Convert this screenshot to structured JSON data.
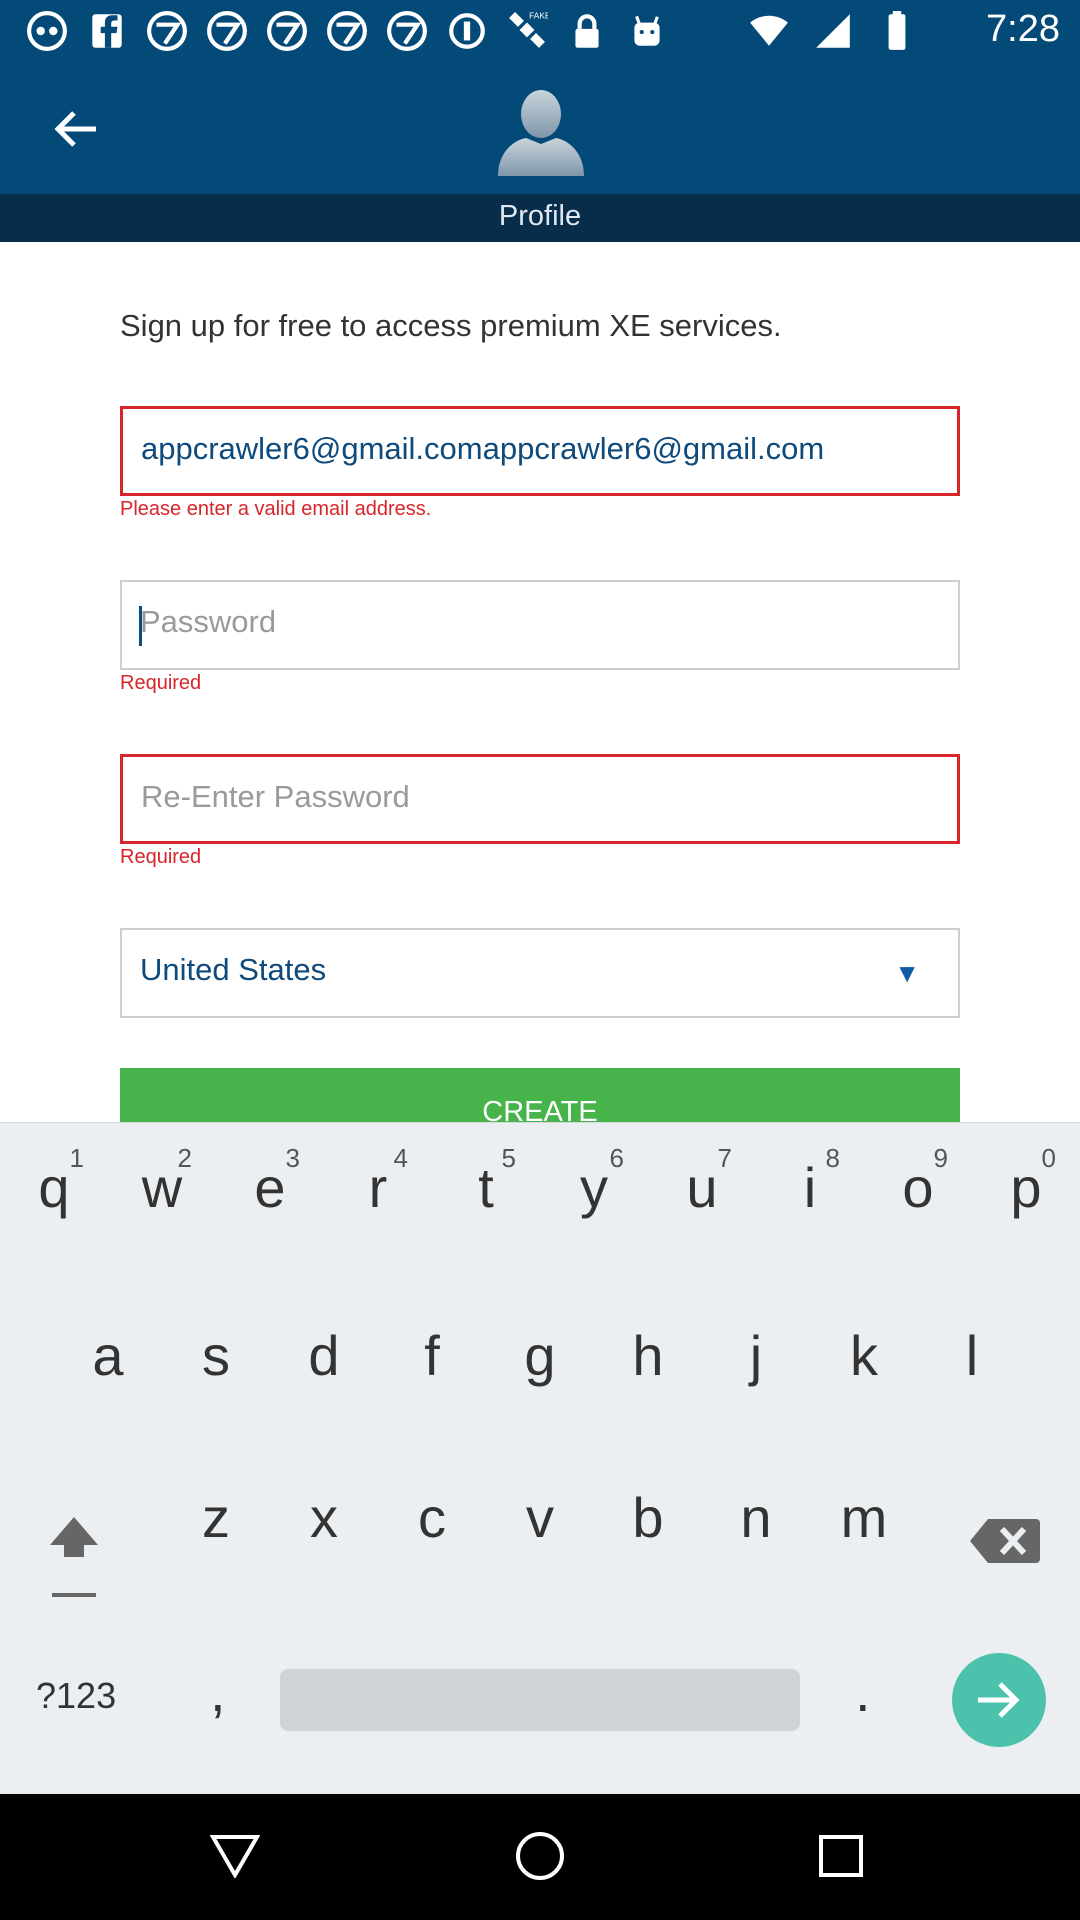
{
  "status_bar": {
    "time": "7:28",
    "icons": [
      "abc7-icon",
      "fb-icon",
      "abc7-icon",
      "abc7-icon",
      "abc7-icon",
      "abc7-icon",
      "abc7-icon",
      "circle-i-icon",
      "fake-gps-icon",
      "lock-icon",
      "android-icon"
    ]
  },
  "header": {
    "tab_label": "Profile"
  },
  "form": {
    "intro": "Sign up for free to access premium XE services.",
    "email_value": "appcrawler6@gmail.comappcrawler6@gmail.com",
    "email_error": "Please enter a valid email address.",
    "password_placeholder": "Password",
    "password_error": "Required",
    "reenter_placeholder": "Re-Enter Password",
    "reenter_error": "Required",
    "country_value": "United States",
    "create_label": "CREATE"
  },
  "keyboard": {
    "row1": [
      {
        "l": "q",
        "n": "1"
      },
      {
        "l": "w",
        "n": "2"
      },
      {
        "l": "e",
        "n": "3"
      },
      {
        "l": "r",
        "n": "4"
      },
      {
        "l": "t",
        "n": "5"
      },
      {
        "l": "y",
        "n": "6"
      },
      {
        "l": "u",
        "n": "7"
      },
      {
        "l": "i",
        "n": "8"
      },
      {
        "l": "o",
        "n": "9"
      },
      {
        "l": "p",
        "n": "0"
      }
    ],
    "row2": [
      "a",
      "s",
      "d",
      "f",
      "g",
      "h",
      "j",
      "k",
      "l"
    ],
    "row3": [
      "z",
      "x",
      "c",
      "v",
      "b",
      "n",
      "m"
    ],
    "symbols_label": "?123",
    "comma_label": ",",
    "period_label": "."
  },
  "colors": {
    "app_bar": "#044a78",
    "error": "#d8252a",
    "create_button": "#47b34b"
  }
}
